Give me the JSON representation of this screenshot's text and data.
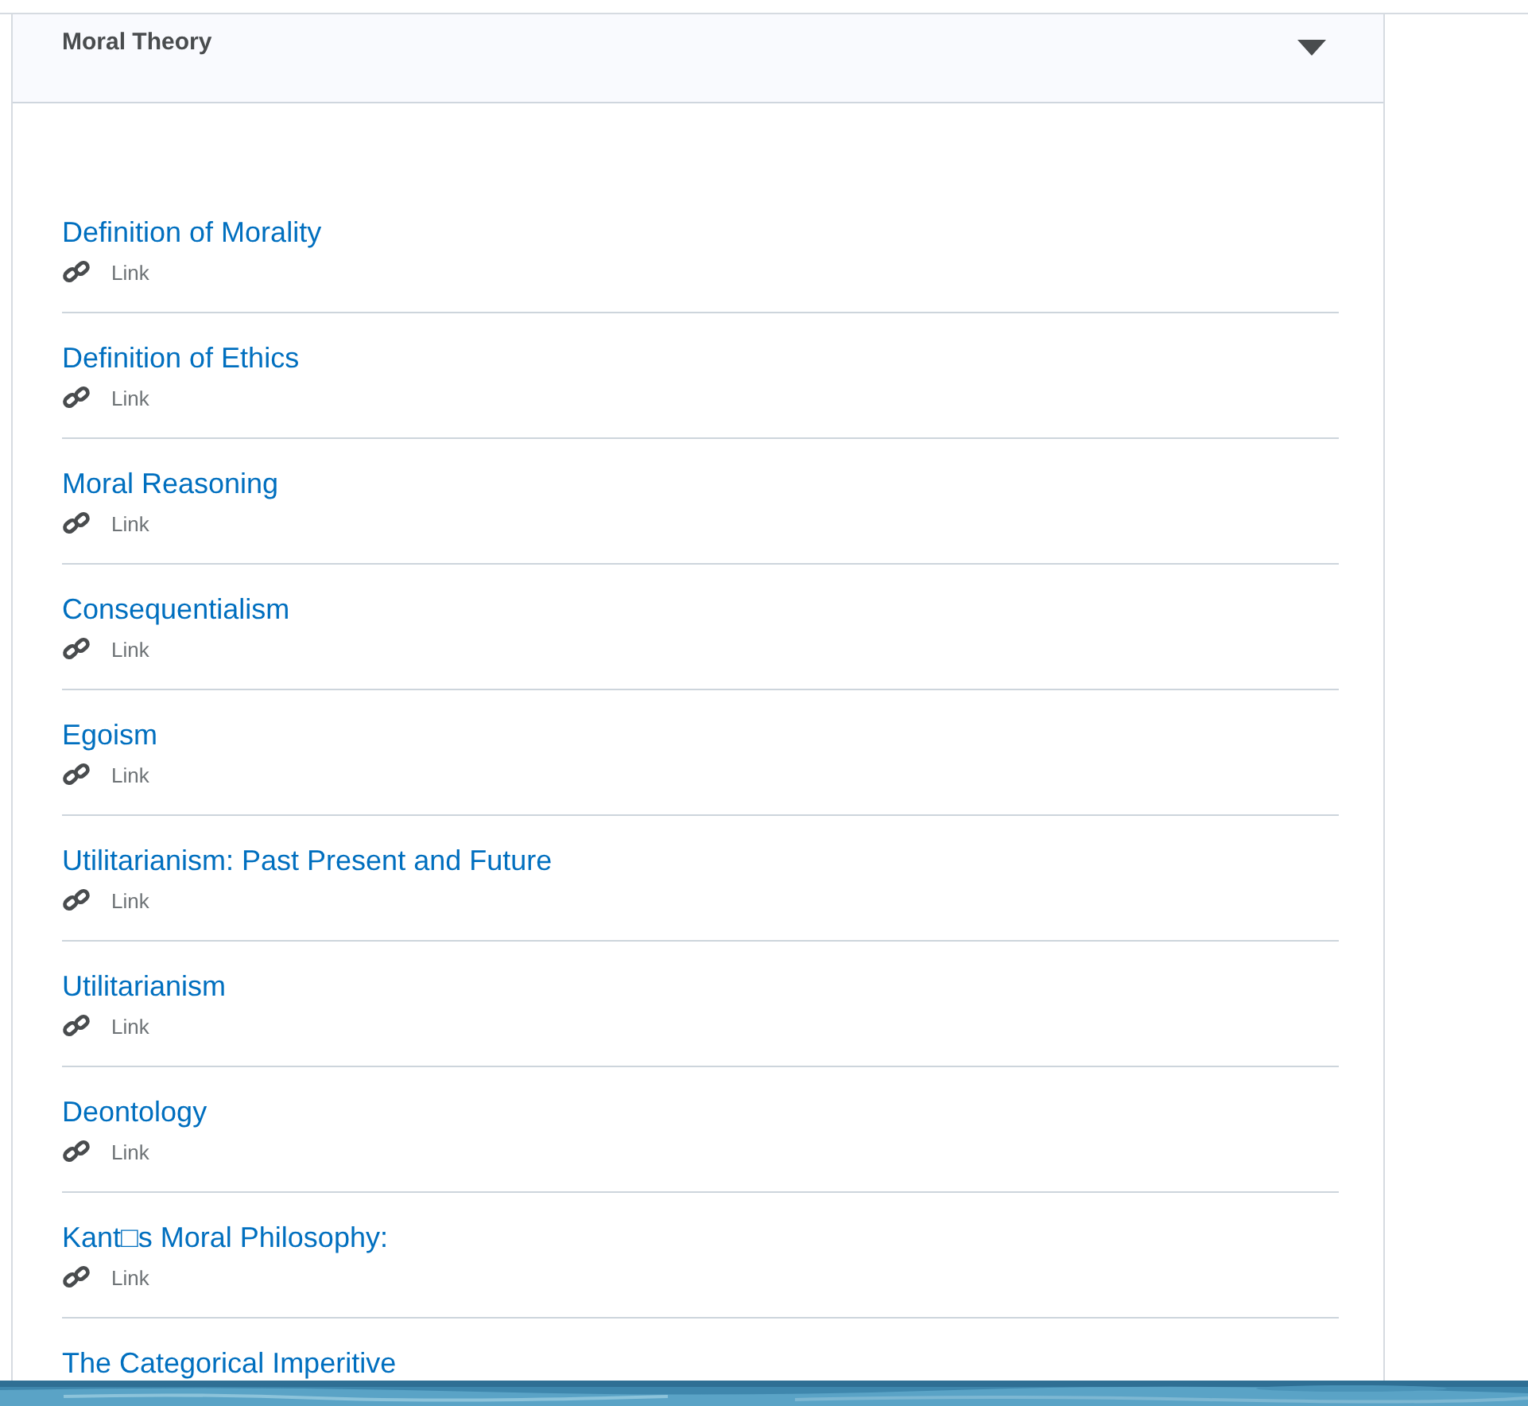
{
  "module": {
    "title": "Moral Theory",
    "expanded": true
  },
  "items": [
    {
      "title": "Definition of Morality",
      "type": "Link"
    },
    {
      "title": "Definition of Ethics",
      "type": "Link"
    },
    {
      "title": "Moral Reasoning",
      "type": "Link"
    },
    {
      "title": "Consequentialism",
      "type": "Link"
    },
    {
      "title": "Egoism",
      "type": "Link"
    },
    {
      "title": "Utilitarianism: Past Present and Future",
      "type": "Link"
    },
    {
      "title": "Utilitarianism",
      "type": "Link"
    },
    {
      "title": "Deontology",
      "type": "Link"
    },
    {
      "title": "Kant□s Moral Philosophy:",
      "type": "Link"
    },
    {
      "title": "The Categorical Imperitive"
    }
  ]
}
